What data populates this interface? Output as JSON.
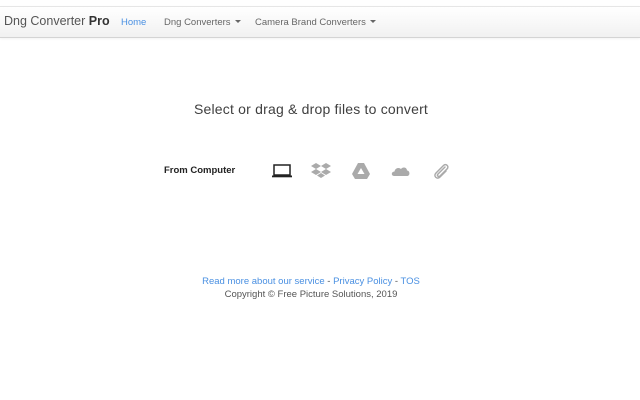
{
  "brand": {
    "name": "Dng Converter",
    "suffix": "Pro"
  },
  "nav": {
    "home": "Home",
    "dng_converters": "Dng Converters",
    "camera_brand_converters": "Camera Brand Converters"
  },
  "main": {
    "headline": "Select or drag & drop files to convert",
    "source_label": "From Computer",
    "sources": [
      {
        "name": "computer",
        "icon": "laptop-icon"
      },
      {
        "name": "dropbox",
        "icon": "dropbox-icon"
      },
      {
        "name": "google-drive",
        "icon": "google-drive-icon"
      },
      {
        "name": "onedrive",
        "icon": "cloud-icon"
      },
      {
        "name": "url",
        "icon": "paperclip-icon"
      }
    ]
  },
  "footer": {
    "read_more": "Read more about our service",
    "sep1": " - ",
    "privacy": "Privacy Policy",
    "sep2": " - ",
    "tos": "TOS",
    "copyright": "Copyright © Free Picture Solutions, 2019"
  },
  "colors": {
    "accent": "#4a90e2",
    "icon_active": "#222222",
    "icon_inactive": "#aaaaaa"
  }
}
